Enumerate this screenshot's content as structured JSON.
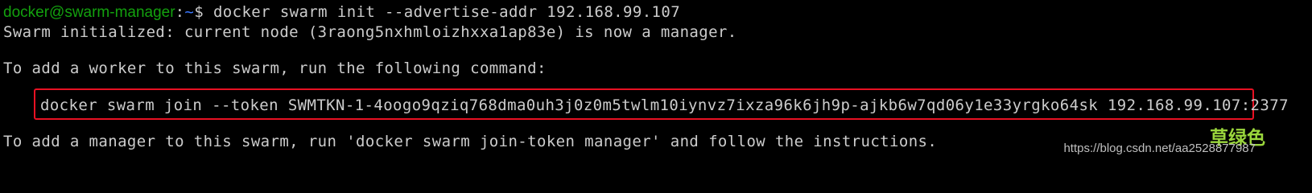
{
  "terminal": {
    "prompt": {
      "user_host": "docker@swarm-manager",
      "colon": ":",
      "path": "~",
      "symbol": "$"
    },
    "command": " docker swarm init --advertise-addr 192.168.99.107",
    "output_line_1": "Swarm initialized: current node (3raong5nxhmloizhxxa1ap83e) is now a manager.",
    "output_line_2": "To add a worker to this swarm, run the following command:",
    "join_command": "docker swarm join --token SWMTKN-1-4oogo9qziq768dma0uh3j0z0m5twlm10iynvz7ixza96k6jh9p-ajkb6w7qd06y1e33yrgko64sk 192.168.99.107:2377",
    "output_line_3": "To add a manager to this swarm, run 'docker swarm join-token manager' and follow the instructions."
  },
  "watermark": {
    "brand": "草绿色",
    "url": "https://blog.csdn.net/aa2528877987"
  },
  "colors": {
    "background": "#000000",
    "text": "#cccccc",
    "prompt_user": "#13a10e",
    "prompt_path": "#3b78ff",
    "highlight_border": "#e81123",
    "watermark_brand": "#9ad63c"
  }
}
